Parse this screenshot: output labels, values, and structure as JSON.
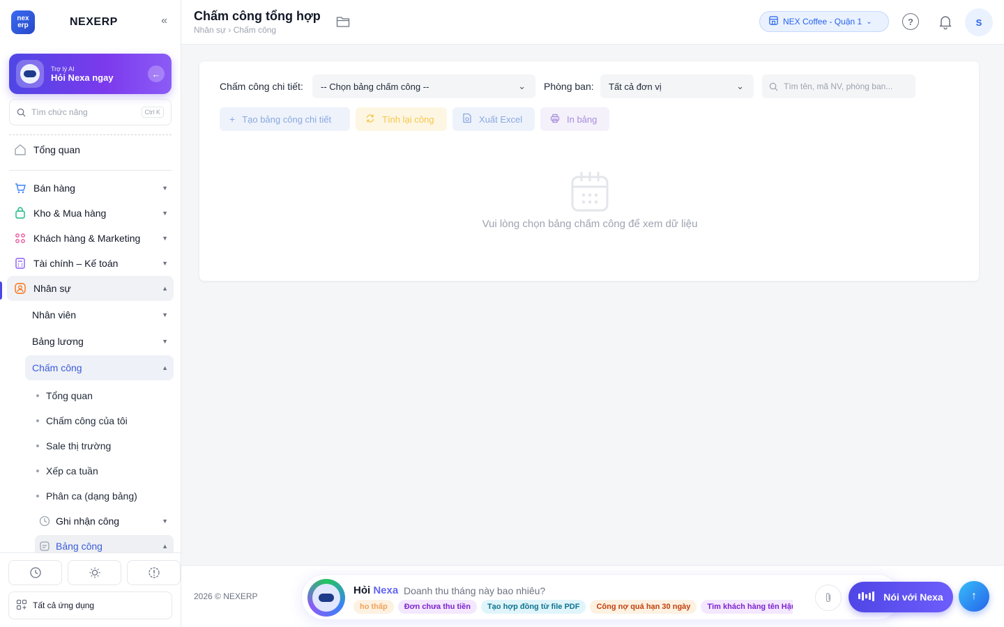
{
  "app": {
    "brand": "NEXERP",
    "logo_text": "nex erp"
  },
  "sidebar": {
    "ai_card": {
      "small": "Trợ lý AI",
      "big": "Hỏi Nexa ngay"
    },
    "search_placeholder": "Tìm chức năng",
    "search_shortcut": "Ctrl K",
    "overview": "Tổng quan",
    "groups": [
      {
        "label": "Bán hàng",
        "icon": "cart-icon"
      },
      {
        "label": "Kho & Mua hàng",
        "icon": "bag-icon"
      },
      {
        "label": "Khách hàng & Marketing",
        "icon": "people-icon"
      },
      {
        "label": "Tài chính – Kế toán",
        "icon": "calculator-icon"
      },
      {
        "label": "Nhân sự",
        "icon": "person-icon"
      }
    ],
    "hr_sub": [
      {
        "label": "Nhân viên"
      },
      {
        "label": "Bảng lương"
      },
      {
        "label": "Chấm công"
      }
    ],
    "timekeeping_leaves": [
      "Tổng quan",
      "Chấm công của tôi",
      "Sale thị trường",
      "Xếp ca tuần",
      "Phân ca (dạng bảng)"
    ],
    "timekeeping_groups": [
      {
        "label": "Ghi nhận công",
        "icon": "clock-icon"
      },
      {
        "label": "Bảng công",
        "icon": "table-icon"
      }
    ],
    "all_apps": "Tất cả ứng dụng"
  },
  "header": {
    "title": "Chấm công tổng hợp",
    "breadcrumb": "Nhân sự › Chấm công",
    "store": "NEX Coffee - Quận 1",
    "help": "?",
    "avatar": "S"
  },
  "filters": {
    "detail_label": "Chấm công chi tiết:",
    "detail_value": "-- Chọn bảng chấm công --",
    "dept_label": "Phòng ban:",
    "dept_value": "Tất cả đơn vị",
    "search_placeholder": "Tìm tên, mã NV, phòng ban..."
  },
  "actions": {
    "create": "Tạo bảng công chi tiết",
    "recalc": "Tính lại công",
    "excel": "Xuất Excel",
    "print": "In bảng"
  },
  "empty_state": "Vui lòng chọn bảng chấm công để xem dữ liệu",
  "footer": {
    "copyright": "2026 © NEXERP",
    "ask_prefix": "Hỏi",
    "ask_brand": "Nexa",
    "ask_placeholder": "Doanh thu tháng này bao nhiêu?",
    "chips": [
      "ho thấp",
      "Đơn chưa thu tiền",
      "Tạo hợp đồng từ file PDF",
      "Công nợ quá hạn 30 ngày",
      "Tìm khách hàng tên Hậu"
    ],
    "talk_button": "Nói với Nexa"
  }
}
